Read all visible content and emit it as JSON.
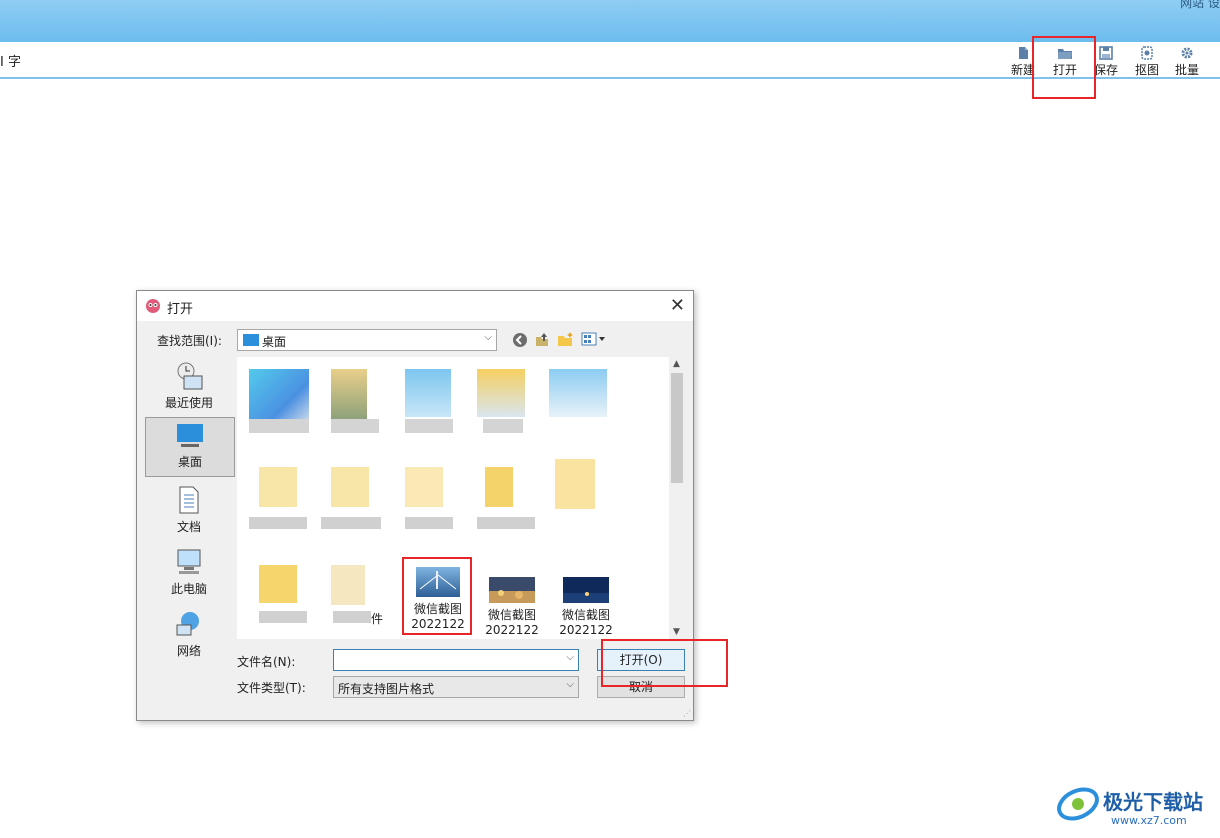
{
  "app": {
    "title_right": "网站 设",
    "left_label": "I 字"
  },
  "toolbar": {
    "buttons": [
      {
        "label": "新建",
        "icon": "new-file-icon"
      },
      {
        "label": "打开",
        "icon": "open-folder-icon"
      },
      {
        "label": "保存",
        "icon": "save-icon"
      },
      {
        "label": "抠图",
        "icon": "cutout-icon"
      },
      {
        "label": "批量",
        "icon": "batch-gear-icon"
      }
    ]
  },
  "dialog": {
    "title": "打开",
    "look_in_label": "查找范围(I):",
    "look_in_value": "桌面",
    "places": [
      {
        "label": "最近使用",
        "icon": "recent-icon"
      },
      {
        "label": "桌面",
        "icon": "desktop-icon"
      },
      {
        "label": "文档",
        "icon": "documents-icon"
      },
      {
        "label": "此电脑",
        "icon": "computer-icon"
      },
      {
        "label": "网络",
        "icon": "network-icon"
      }
    ],
    "files": [
      {
        "name": "微信截图",
        "sub": "2022122"
      },
      {
        "name": "微信截图",
        "sub": "2022122"
      },
      {
        "name": "微信截图",
        "sub": "2022122"
      }
    ],
    "partial_file_label": "件",
    "filename_label": "文件名(N):",
    "filename_value": "",
    "filetype_label": "文件类型(T):",
    "filetype_value": "所有支持图片格式",
    "open_button": "打开(O)",
    "cancel_button": "取消"
  },
  "watermark": {
    "text": "极光下载站",
    "url": "www.xz7.com"
  },
  "colors": {
    "titlebar": "#7cc4f0",
    "highlight_box": "#e8262a"
  }
}
